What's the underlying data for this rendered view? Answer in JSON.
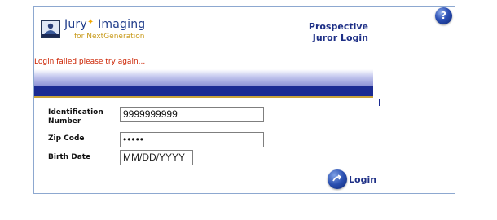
{
  "header": {
    "logo_title": "Jury",
    "logo_title_2": "Imaging",
    "logo_subtitle": "for NextGeneration",
    "heading_line1": "Prospective",
    "heading_line2": "Juror Login"
  },
  "error_message": "Login failed please try again...",
  "form": {
    "identification_label_line1": "Identification",
    "identification_label_line2": "Number",
    "identification_value": "9999999999",
    "zip_label": "Zip Code",
    "zip_value": "•••••",
    "birth_label": "Birth Date",
    "birth_placeholder": "MM/DD/YYYY"
  },
  "login_button": {
    "label": "Login"
  },
  "help_button": {
    "label": "?"
  },
  "icons": {
    "logo": "jury-imaging-logo-icon",
    "help": "help-icon",
    "login": "login-arrow-icon"
  },
  "colors": {
    "brand_blue": "#1d2f86",
    "error": "#cc2200",
    "band_dark": "#1a2a92",
    "accent_gold": "#c8a23a"
  }
}
